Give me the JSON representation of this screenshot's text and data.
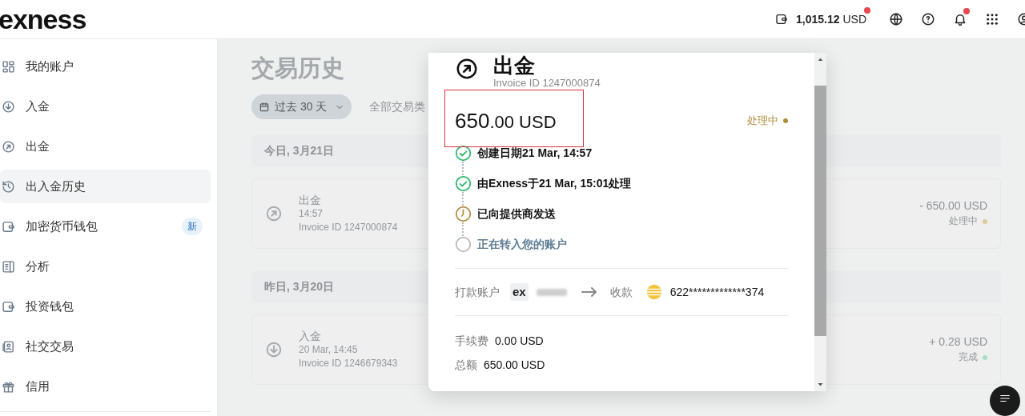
{
  "header": {
    "logo": "exness",
    "balance": {
      "amount": "1,015.12",
      "currency": "USD",
      "alert": true
    },
    "notifications_alert": true
  },
  "sidebar": {
    "items": [
      {
        "label": "我的账户",
        "selected": false
      },
      {
        "label": "入金",
        "selected": false
      },
      {
        "label": "出金",
        "selected": false
      },
      {
        "label": "出入金历史",
        "selected": true
      },
      {
        "label": "加密货币钱包",
        "selected": false,
        "badge": "新"
      },
      {
        "label": "分析",
        "selected": false
      },
      {
        "label": "投资钱包",
        "selected": false
      },
      {
        "label": "社交交易",
        "selected": false
      },
      {
        "label": "信用",
        "selected": false
      }
    ]
  },
  "main": {
    "title": "交易历史",
    "filters": [
      {
        "kind": "date",
        "label": "过去 30 天"
      },
      {
        "kind": "plain",
        "label": "全部交易类"
      }
    ],
    "groups": [
      {
        "date": "今日, 3月21日",
        "transactions": [
          {
            "kind": "withdrawal",
            "title": "出金",
            "time": "14:57",
            "invoice": "Invoice ID 1247000874",
            "amount": "- 650.00 USD",
            "status": "处理中",
            "color": "#dccb9c"
          }
        ]
      },
      {
        "date": "昨日, 3月20日",
        "transactions": [
          {
            "kind": "deposit",
            "title": "入金",
            "time": "20 Mar, 14:45",
            "invoice": "Invoice ID 1246679343",
            "amount": "+ 0.28 USD",
            "status": "完成",
            "color": "#a9dfc6"
          }
        ]
      }
    ]
  },
  "modal": {
    "title": "出金",
    "invoice": "Invoice ID 1247000874",
    "amount": "650",
    "decimals": ".00",
    "currency": "USD",
    "status": "处理中",
    "steps": [
      {
        "kind": "done",
        "text": "创建日期21 Mar, 14:57"
      },
      {
        "kind": "done",
        "text": "由Exness于21 Mar, 15:01处理"
      },
      {
        "kind": "pending",
        "text": "已向提供商发送"
      },
      {
        "kind": "todo",
        "text": "正在转入您的账户"
      }
    ],
    "transfer": {
      "from_label": "打款账户",
      "from_logo": "ex",
      "to_label": "收款",
      "card": "622*************374"
    },
    "fees": [
      {
        "label": "手续费",
        "value": "0.00 USD"
      },
      {
        "label": "总额",
        "value": "650.00 USD"
      }
    ]
  }
}
